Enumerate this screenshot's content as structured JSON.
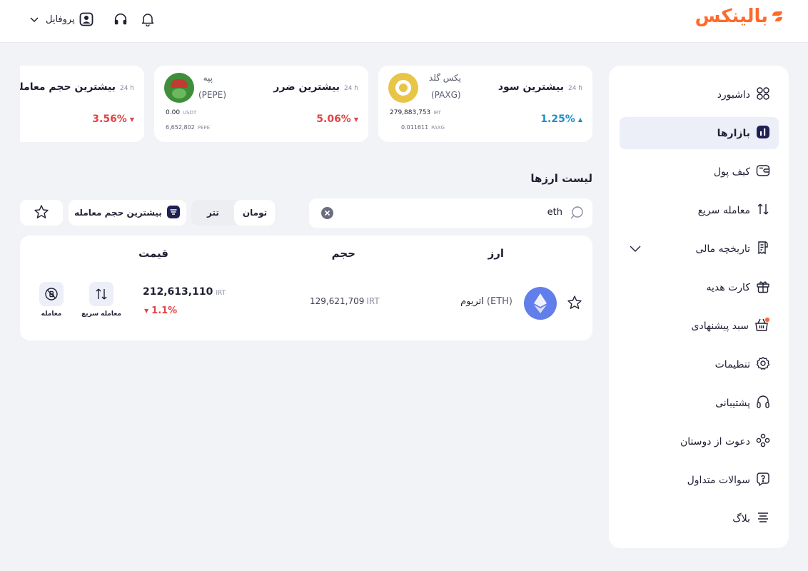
{
  "brand": {
    "logo_text": "بالینکس",
    "accent": "#ff6a2a"
  },
  "topbar": {
    "profile_label": "پروفایل"
  },
  "sidebar": {
    "items": [
      {
        "label": "داشبورد",
        "icon": "dashboard-grid-icon"
      },
      {
        "label": "بازارها",
        "icon": "markets-chart-icon",
        "active": true
      },
      {
        "label": "کیف پول",
        "icon": "wallet-icon"
      },
      {
        "label": "معامله سریع",
        "icon": "swap-arrows-icon"
      },
      {
        "label": "تاریخچه مالی",
        "icon": "receipt-icon",
        "expandable": true
      },
      {
        "label": "کارت هدیه",
        "icon": "gift-icon"
      },
      {
        "label": "سبد پیشنهادی",
        "icon": "basket-icon",
        "badge_dot": true
      },
      {
        "label": "تنظیمات",
        "icon": "gear-icon"
      },
      {
        "label": "پشتیبانی",
        "icon": "headset-icon"
      },
      {
        "label": "دعوت از دوستان",
        "icon": "friends-icon"
      },
      {
        "label": "سوالات متداول",
        "icon": "question-icon"
      },
      {
        "label": "بلاگ",
        "icon": "blog-lines-icon"
      }
    ]
  },
  "stats": {
    "gain": {
      "title": "بیشترین سود",
      "period": "24 h",
      "coin_name": "پکس گلد",
      "coin_symbol": "(PAXG)",
      "price_value": "279,883,753",
      "price_unit": "IRT",
      "amount_value": "0.011611",
      "amount_unit": "PAXG",
      "change": "1.25%",
      "direction": "up"
    },
    "loss": {
      "title": "بیشترین ضرر",
      "period": "24 h",
      "coin_name": "پپه",
      "coin_symbol": "(PEPE)",
      "price_value": "0.00",
      "price_unit": "USDT",
      "amount_value": "6,652,802",
      "amount_unit": "PEPE",
      "change": "5.06%",
      "direction": "down"
    },
    "volume": {
      "title": "بیشترین حجم معامله",
      "period": "24 h",
      "change": "3.56%",
      "direction": "down"
    }
  },
  "list": {
    "title": "لیست ارزها",
    "search_value": "eth",
    "filters": {
      "toman": "تومان",
      "tether": "تتر",
      "sort": "بیشترین حجم معامله"
    },
    "headers": {
      "coin": "ارز",
      "volume": "حجم",
      "price": "قیمت"
    },
    "rows": [
      {
        "name": "اتریوم",
        "symbol": "(ETH)",
        "volume_value": "129,621,709",
        "volume_unit": "IRT",
        "price_value": "212,613,110",
        "price_unit": "IRT",
        "change": "1.1%",
        "direction": "down",
        "quick_trade_label": "معامله سریع",
        "trade_label": "معامله"
      }
    ]
  },
  "colors": {
    "negative": "#e04545",
    "positive": "#1d8fc7",
    "eth": "#627eea",
    "paxg": "#e8c547",
    "pepe": "#3f8f3a"
  }
}
